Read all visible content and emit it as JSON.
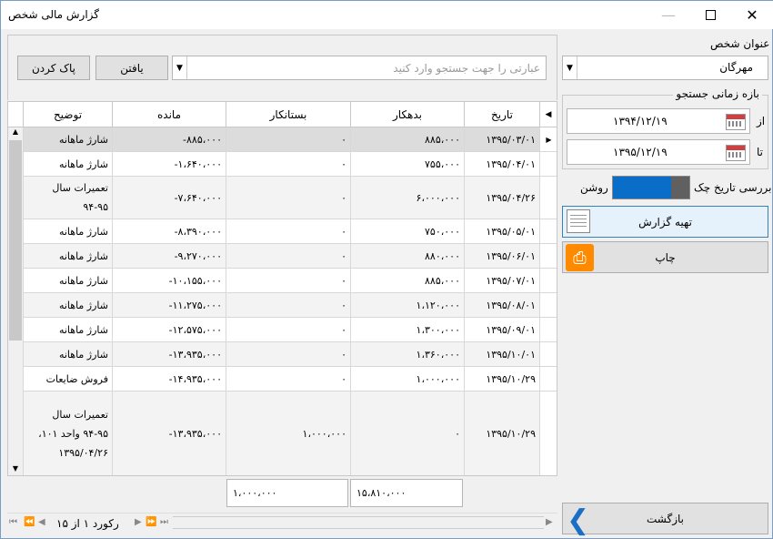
{
  "window": {
    "title": "گزارش مالی شخص"
  },
  "person": {
    "label": "عنوان شخص",
    "value": "مهرگان"
  },
  "range": {
    "label": "بازه زمانی جستجو",
    "from_label": "از",
    "from_value": "۱۳۹۴/۱۲/۱۹",
    "to_label": "تا",
    "to_value": "۱۳۹۵/۱۲/۱۹"
  },
  "check": {
    "label": "بررسی تاریخ چک",
    "state": "روشن"
  },
  "actions": {
    "report": "تهیه گزارش",
    "print": "چاپ",
    "back": "بازگشت"
  },
  "search": {
    "placeholder": "عبارتی را جهت جستجو وارد کنید",
    "find": "یافتن",
    "clear": "پاک کردن"
  },
  "table": {
    "headers": [
      "تاریخ",
      "بدهکار",
      "بستانکار",
      "مانده",
      "توضیح"
    ],
    "rows": [
      {
        "date": "۱۳۹۵/۰۳/۰۱",
        "debit": "۸۸۵،۰۰۰",
        "credit": "۰",
        "balance": "-۸۸۵،۰۰۰",
        "desc": "شارژ ماهانه"
      },
      {
        "date": "۱۳۹۵/۰۴/۰۱",
        "debit": "۷۵۵،۰۰۰",
        "credit": "۰",
        "balance": "-۱،۶۴۰،۰۰۰",
        "desc": "شارژ ماهانه"
      },
      {
        "date": "۱۳۹۵/۰۴/۲۶",
        "debit": "۶،۰۰۰،۰۰۰",
        "credit": "۰",
        "balance": "-۷،۶۴۰،۰۰۰",
        "desc": "تعمیرات سال ۹۵-۹۴"
      },
      {
        "date": "۱۳۹۵/۰۵/۰۱",
        "debit": "۷۵۰،۰۰۰",
        "credit": "۰",
        "balance": "-۸،۳۹۰،۰۰۰",
        "desc": "شارژ ماهانه"
      },
      {
        "date": "۱۳۹۵/۰۶/۰۱",
        "debit": "۸۸۰،۰۰۰",
        "credit": "۰",
        "balance": "-۹،۲۷۰،۰۰۰",
        "desc": "شارژ ماهانه"
      },
      {
        "date": "۱۳۹۵/۰۷/۰۱",
        "debit": "۸۸۵،۰۰۰",
        "credit": "۰",
        "balance": "-۱۰،۱۵۵،۰۰۰",
        "desc": "شارژ ماهانه"
      },
      {
        "date": "۱۳۹۵/۰۸/۰۱",
        "debit": "۱،۱۲۰،۰۰۰",
        "credit": "۰",
        "balance": "-۱۱،۲۷۵،۰۰۰",
        "desc": "شارژ ماهانه"
      },
      {
        "date": "۱۳۹۵/۰۹/۰۱",
        "debit": "۱،۳۰۰،۰۰۰",
        "credit": "۰",
        "balance": "-۱۲،۵۷۵،۰۰۰",
        "desc": "شارژ ماهانه"
      },
      {
        "date": "۱۳۹۵/۱۰/۰۱",
        "debit": "۱،۳۶۰،۰۰۰",
        "credit": "۰",
        "balance": "-۱۳،۹۳۵،۰۰۰",
        "desc": "شارژ ماهانه"
      },
      {
        "date": "۱۳۹۵/۱۰/۲۹",
        "debit": "۱،۰۰۰،۰۰۰",
        "credit": "۰",
        "balance": "-۱۴،۹۳۵،۰۰۰",
        "desc": "فروش ضایعات"
      },
      {
        "date": "۱۳۹۵/۱۰/۲۹",
        "debit": "۰",
        "credit": "۱،۰۰۰،۰۰۰",
        "balance": "-۱۳،۹۳۵،۰۰۰",
        "desc": "تعمیرات سال ۹۵-۹۴ واحد ۱۰۱، ۱۳۹۵/۰۴/۲۶"
      }
    ]
  },
  "totals": {
    "debit": "۱۵،۸۱۰،۰۰۰",
    "credit": "۱،۰۰۰،۰۰۰"
  },
  "nav": {
    "record": "رکورد ۱ از ۱۵"
  }
}
